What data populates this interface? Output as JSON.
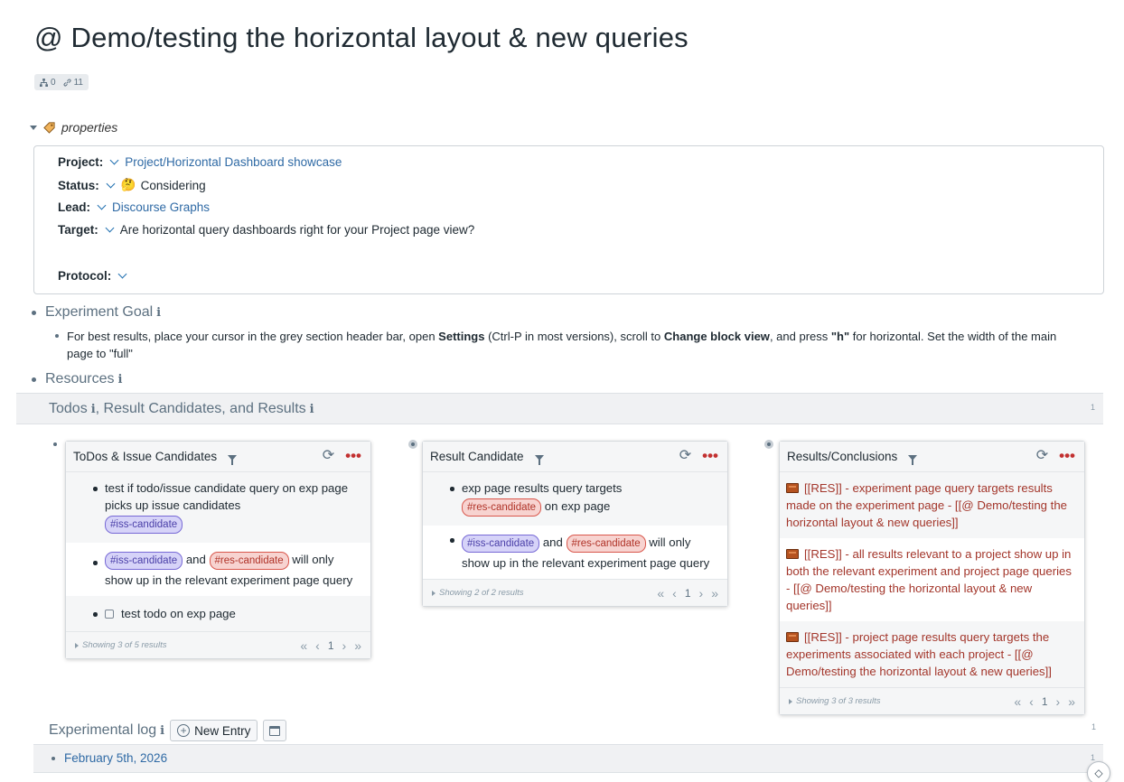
{
  "page": {
    "title": "@ Demo/testing the horizontal layout & new queries",
    "counts": {
      "children": "0",
      "links": "11"
    }
  },
  "properties": {
    "toggle_label": "properties",
    "rows": [
      {
        "key": "Project:",
        "value": "Project/Horizontal Dashboard showcase"
      },
      {
        "key": "Status:",
        "value": "Considering",
        "emoji": "🤔"
      },
      {
        "key": "Lead:",
        "value": "Discourse Graphs"
      },
      {
        "key": "Target:",
        "value": "Are horizontal query dashboards right for your Project page view?"
      },
      {
        "key": "Protocol:",
        "value": ""
      }
    ]
  },
  "experiment_goal": {
    "heading": "Experiment Goal",
    "text_parts": [
      "For best results, place your cursor in the grey section header bar, open ",
      "Settings",
      " (Ctrl-P in most versions), scroll to ",
      "Change block view",
      ", and press ",
      "\"h\"",
      " for horizontal. Set the width of the main page to \"full\""
    ]
  },
  "resources": {
    "heading": "Resources"
  },
  "dashboard_bar": {
    "title_parts": [
      "Todos",
      ", Result Candidates,  and Results"
    ],
    "count": "1"
  },
  "panels": {
    "todos": {
      "title": "ToDos &  Issue Candidates",
      "rows": [
        {
          "text": "test if  todo/issue candidate query on exp page picks up issue candidates",
          "tag": "#iss-candidate"
        },
        {
          "tag1": "#iss-candidate",
          "and": "and",
          "tag2": "#res-candidate",
          "text": "will only show up in the relevant experiment page query"
        },
        {
          "text": "test todo on exp page"
        }
      ],
      "footer": "Showing 3 of 5 results",
      "page": "1"
    },
    "candidates": {
      "title": "Result Candidate",
      "rows": [
        {
          "text": "exp page results query targets",
          "tag": "#res-candidate",
          "after": "on exp page"
        },
        {
          "tag1": "#iss-candidate",
          "and": "and",
          "tag2": "#res-candidate",
          "text": "will only show up in the relevant experiment page query"
        }
      ],
      "footer": "Showing 2 of 2 results",
      "page": "1"
    },
    "results": {
      "title": "Results/Conclusions",
      "rows": [
        "[[RES]] - experiment page query targets results made on the experiment page - [[@ Demo/testing the horizontal layout & new queries]]",
        "[[RES]] - all results relevant to a project show up in both the relevant experiment and project page queries  - [[@ Demo/testing the horizontal layout & new queries]]",
        "[[RES]] - project page results query targets the experiments associated with each project - [[@ Demo/testing the horizontal layout & new queries]]"
      ],
      "footer": "Showing 3 of 3 results",
      "page": "1"
    }
  },
  "experimental_log": {
    "heading": "Experimental log",
    "new_entry_label": "New Entry",
    "count": "1",
    "entries": [
      {
        "date": "February 5th, 2026",
        "count": "1"
      }
    ]
  }
}
